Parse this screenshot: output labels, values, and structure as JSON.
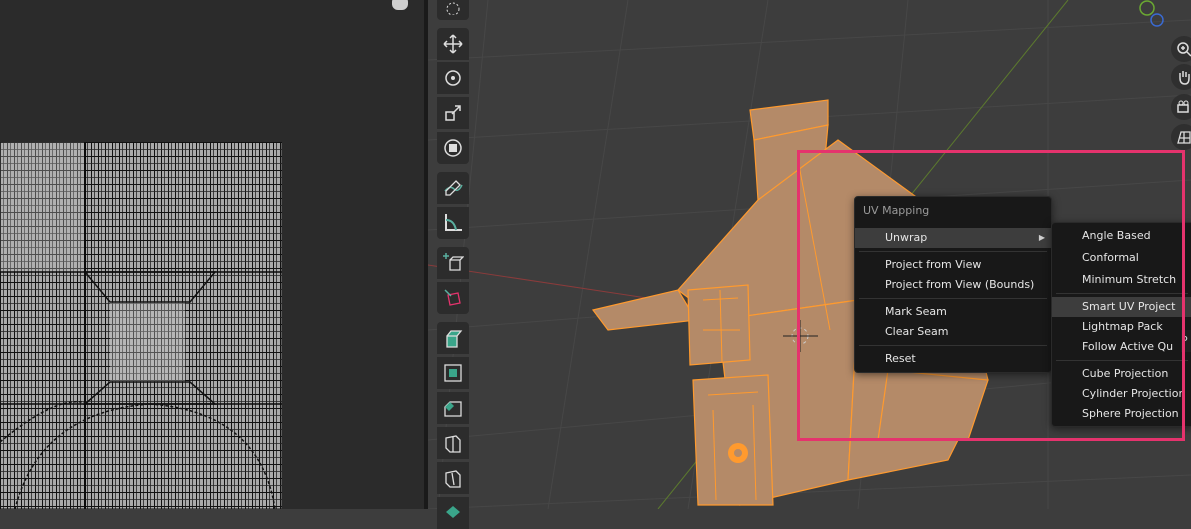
{
  "colors": {
    "highlight": "#e5336d",
    "selection": "#ff9a2e",
    "mesh_face": "#b48a68",
    "background": "#3d3d3d"
  },
  "toolbar": {
    "tools": [
      {
        "name": "select-icon"
      },
      {
        "name": "move-icon"
      },
      {
        "name": "rotate-icon"
      },
      {
        "name": "scale-icon"
      },
      {
        "name": "transform-icon"
      },
      {
        "name": "annotate-icon"
      },
      {
        "name": "measure-icon"
      },
      {
        "name": "add-cube-icon"
      },
      {
        "name": "rotate-cube-icon"
      },
      {
        "name": "extrude-icon"
      },
      {
        "name": "inset-icon"
      },
      {
        "name": "bevel-icon"
      },
      {
        "name": "loop-cut-icon"
      },
      {
        "name": "knife-icon"
      },
      {
        "name": "poly-build-icon"
      }
    ]
  },
  "uv_menu": {
    "title": "UV Mapping",
    "items": [
      {
        "label": "Unwrap",
        "has_submenu": true
      },
      {
        "label": "Project from View"
      },
      {
        "label": "Project from View (Bounds)"
      },
      {
        "label": "Mark Seam"
      },
      {
        "label": "Clear Seam"
      },
      {
        "label": "Reset"
      }
    ]
  },
  "unwrap_submenu": {
    "items": [
      {
        "label": "Angle Based"
      },
      {
        "label": "Conformal"
      },
      {
        "label": "Minimum Stretch"
      },
      {
        "label": "Smart UV Project"
      },
      {
        "label": "Lightmap Pack"
      },
      {
        "label": "Follow Active Qu"
      },
      {
        "label": "Cube Projection"
      },
      {
        "label": "Cylinder Projection"
      },
      {
        "label": "Sphere Projection"
      }
    ]
  },
  "tooltip_fragment": "P"
}
